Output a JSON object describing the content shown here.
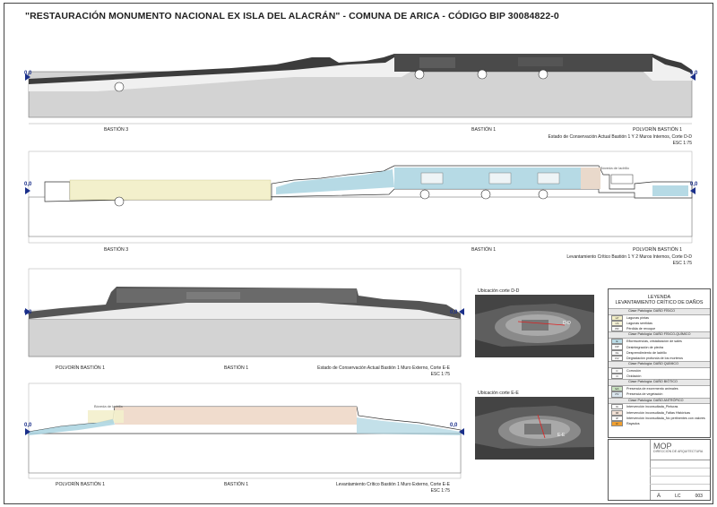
{
  "title": "\"RESTAURACIÓN MONUMENTO NACIONAL EX ISLA DEL ALACRÁN\" - COMUNA DE ARICA - CÓDIGO BIP 30084822-0",
  "zero_label": "0,0",
  "sections": [
    {
      "labels": [
        "BASTIÓN 3",
        "BASTIÓN 1",
        "POLVORÍN BASTIÓN 1"
      ],
      "caption": "Estado de Conservación Actual Bastión 1 Y 2 Muros Internos, Corte D-D",
      "scale": "ESC 1:75"
    },
    {
      "labels": [
        "BASTIÓN 3",
        "BASTIÓN 1",
        "POLVORÍN BASTIÓN 1"
      ],
      "caption": "Levantamiento Crítico Bastión 1 Y 2 Muros Internos, Corte D-D",
      "scale": "ESC 1:75",
      "annotations": [
        "Bóveda de ladrillo",
        "Bóveda de ladrillo"
      ]
    },
    {
      "labels": [
        "POLVORÍN BASTIÓN 1",
        "BASTIÓN 1"
      ],
      "caption": "Estado de Conservación Actual Bastión 1 Muro Externo, Corte E-E",
      "scale": "ESC 1:75"
    },
    {
      "labels": [
        "POLVORÍN BASTIÓN 1",
        "BASTIÓN 1"
      ],
      "caption": "Levantamiento Crítico Bastión 1 Muro Externo, Corte E-E",
      "scale": "ESC 1:75",
      "annotations": [
        "Bóveda de ladrillo"
      ]
    }
  ],
  "photos": {
    "dd_label": "Ubicación corte D-D",
    "ee_label": "Ubicación corte E-E"
  },
  "legend": {
    "title_line1": "LEYENDA",
    "title_line2": "LEVANTAMIENTO CRÍTICO DE DAÑOS",
    "groups": [
      {
        "category": "Clase Patología: DAÑO FÍSICO",
        "items": [
          {
            "code": "LP",
            "label": "Lagunas pintas",
            "color": "#f4f0c8"
          },
          {
            "code": "LS",
            "label": "Lagunas sentidas",
            "color": "#f6f3d6"
          },
          {
            "code": "PR",
            "label": "Pérdida de revoque",
            "color": "#ffffff"
          }
        ]
      },
      {
        "category": "Clase Patología: DAÑO FÍSICO-QUÍMICO",
        "items": [
          {
            "code": "E",
            "label": "Eflorescencias, cristalización de sales",
            "color": "#b9dbe6"
          },
          {
            "code": "DP",
            "label": "Desintegración de piedra",
            "color": "#ffffff"
          },
          {
            "code": "DL",
            "label": "Desprendimiento de ladrillo",
            "color": "#ffffff"
          },
          {
            "code": "DV",
            "label": "Degradación profunda de los morteros",
            "color": "#ffffff"
          }
        ]
      },
      {
        "category": "Clase Patología: DAÑO QUÍMICO",
        "items": [
          {
            "code": "C",
            "label": "Corrosión",
            "color": "#ffffff"
          },
          {
            "code": "O",
            "label": "Oxidación",
            "color": "#ffffff"
          }
        ]
      },
      {
        "category": "Clase Patología: DAÑO BIÓTICO",
        "items": [
          {
            "code": "EA",
            "label": "Presencia de excremento animales",
            "color": "#c9e2c0"
          },
          {
            "code": "PV",
            "label": "Presencia de vegetación",
            "color": "#dbe7ef"
          }
        ]
      },
      {
        "category": "Clase Patología: DAÑO ANTRÓPICO",
        "items": [
          {
            "code": "IA",
            "label": "Intervención inconsultada_Pinturas",
            "color": "#ffffff"
          },
          {
            "code": "IM",
            "label": "Intervención inconsultada_Faltas Históricas",
            "color": "#f3e2d6"
          },
          {
            "code": "IP",
            "label": "Intervención inconsultada_No pertinentes con valores",
            "color": "#ffffff"
          },
          {
            "code": "R",
            "label": "Rayados",
            "color": "#f0a030"
          }
        ]
      }
    ]
  },
  "title_block": {
    "org": "MOP",
    "dept": "DIRECCIÓN DE ARQUITECTURA",
    "sheet_letter": "A",
    "code": "LC",
    "number": "003"
  },
  "colors": {
    "section_fill": "#d2d2d2",
    "stone": "#3f3f3f",
    "damage_blue": "#a9d3e0",
    "damage_yellow": "#f3f0cc",
    "damage_peach": "#eed8c8",
    "zero_marker": "#1a2f8a"
  }
}
